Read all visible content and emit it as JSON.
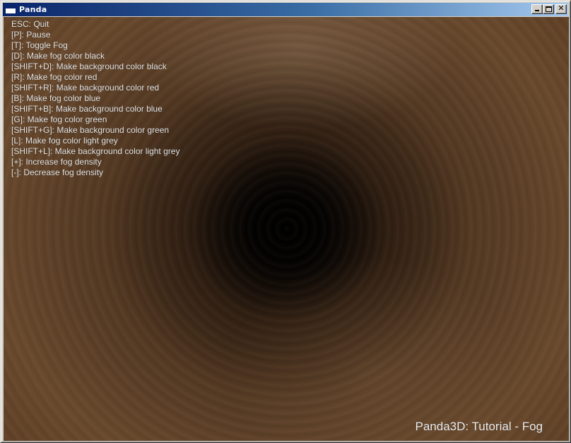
{
  "window": {
    "title": "Panda",
    "icon": "window-app-icon",
    "controls": {
      "minimize": "minimize-icon",
      "maximize": "maximize-icon",
      "close": "close-icon"
    },
    "colors": {
      "titlebar_start": "#0a246a",
      "titlebar_end": "#a6caf0",
      "frame": "#d4d0c8"
    }
  },
  "scene": {
    "help_lines": [
      "ESC: Quit",
      "[P]: Pause",
      "[T]: Toggle Fog",
      "[D]: Make fog color black",
      "[SHIFT+D]: Make background color black",
      "[R]: Make fog color red",
      "[SHIFT+R]: Make background color red",
      "[B]: Make fog color blue",
      "[SHIFT+B]: Make background color blue",
      "[G]: Make fog color green",
      "[SHIFT+G]: Make background color green",
      "[L]: Make fog color light grey",
      "[SHIFT+L]: Make background color light grey",
      "[+]: Increase fog density",
      "[-]: Decrease fog density"
    ],
    "footer_title": "Panda3D: Tutorial - Fog",
    "text_color": "#e6e6e6"
  }
}
